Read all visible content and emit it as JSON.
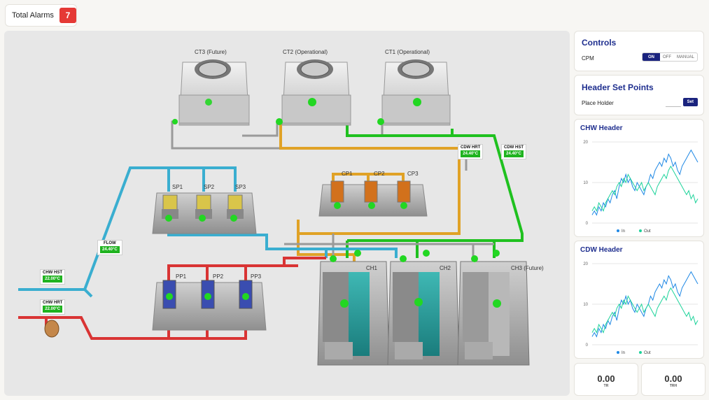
{
  "alarms": {
    "label": "Total Alarms",
    "count": "7"
  },
  "equipment": {
    "ct3": "CT3 (Future)",
    "ct2": "CT2 (Operational)",
    "ct1": "CT1 (Operational)",
    "sp1": "SP1",
    "sp2": "SP2",
    "sp3": "SP3",
    "cp1": "CP1",
    "cp2": "CP2",
    "cp3": "CP3",
    "pp1": "PP1",
    "pp2": "PP2",
    "pp3": "PP3",
    "ch1": "CH1",
    "ch2": "CH2",
    "ch3": "CH3 (Future)"
  },
  "tags": {
    "cdw_hrt": {
      "name": "CDW HRT",
      "value": "24.40°C"
    },
    "cdw_hst": {
      "name": "CDW HST",
      "value": "24.40°C"
    },
    "flow": {
      "name": "FLOW",
      "value": "24.40°C"
    },
    "chw_hst": {
      "name": "CHW HST",
      "value": "22.00°C"
    },
    "chw_hrt": {
      "name": "CHW HRT",
      "value": "22.00°C"
    }
  },
  "controls": {
    "title": "Controls",
    "cpm_label": "CPM",
    "on": "ON",
    "off": "OFF",
    "manual": "MANUAL"
  },
  "setpoints": {
    "title": "Header Set Points",
    "placeholder_label": "Place Holder",
    "set_label": "Set"
  },
  "colors": {
    "chw_pipe": "#3aaed0",
    "cdw_pipe": "#1fc11f",
    "cp_pipe": "#e0a226",
    "return_pipe": "#d93434",
    "in_series": "#1e88e5",
    "out_series": "#1dd39a"
  },
  "chart_data": [
    {
      "type": "line",
      "title": "CHW Header",
      "ylim": [
        0,
        20
      ],
      "yticks": [
        0,
        10,
        20
      ],
      "grid": true,
      "legend": "bottom",
      "series": [
        {
          "name": "In",
          "values": [
            2,
            3,
            2,
            4,
            3,
            5,
            4,
            6,
            5,
            7,
            8,
            6,
            9,
            11,
            10,
            12,
            10,
            11,
            9,
            8,
            10,
            9,
            8,
            7,
            9,
            10,
            12,
            11,
            13,
            14,
            15,
            14,
            16,
            15,
            17,
            16,
            14,
            15,
            13,
            12,
            14,
            15,
            16,
            17,
            18,
            17,
            16,
            15
          ]
        },
        {
          "name": "Out",
          "values": [
            3,
            4,
            3,
            5,
            4,
            3,
            5,
            6,
            7,
            8,
            7,
            9,
            10,
            9,
            11,
            10,
            12,
            11,
            10,
            9,
            8,
            9,
            10,
            8,
            9,
            10,
            9,
            8,
            7,
            9,
            10,
            11,
            12,
            11,
            13,
            14,
            13,
            12,
            11,
            10,
            9,
            8,
            7,
            8,
            6,
            7,
            5,
            6
          ]
        }
      ]
    },
    {
      "type": "line",
      "title": "CDW Header",
      "ylim": [
        0,
        20
      ],
      "yticks": [
        0,
        10,
        20
      ],
      "grid": true,
      "legend": "bottom",
      "series": [
        {
          "name": "In",
          "values": [
            2,
            3,
            2,
            4,
            3,
            5,
            4,
            6,
            5,
            7,
            8,
            6,
            9,
            11,
            10,
            12,
            10,
            11,
            9,
            8,
            10,
            9,
            8,
            7,
            9,
            10,
            12,
            11,
            13,
            14,
            15,
            14,
            16,
            15,
            17,
            16,
            14,
            15,
            13,
            12,
            14,
            15,
            16,
            17,
            18,
            17,
            16,
            15
          ]
        },
        {
          "name": "Out",
          "values": [
            3,
            4,
            3,
            5,
            4,
            3,
            5,
            6,
            7,
            8,
            7,
            9,
            10,
            9,
            11,
            10,
            12,
            11,
            10,
            9,
            8,
            9,
            10,
            8,
            9,
            10,
            9,
            8,
            7,
            9,
            10,
            11,
            12,
            11,
            13,
            14,
            13,
            12,
            11,
            10,
            9,
            8,
            7,
            8,
            6,
            7,
            5,
            6
          ]
        }
      ]
    }
  ],
  "metrics": {
    "tr": {
      "value": "0.00",
      "unit": "TR"
    },
    "trh": {
      "value": "0.00",
      "unit": "TRH"
    }
  }
}
